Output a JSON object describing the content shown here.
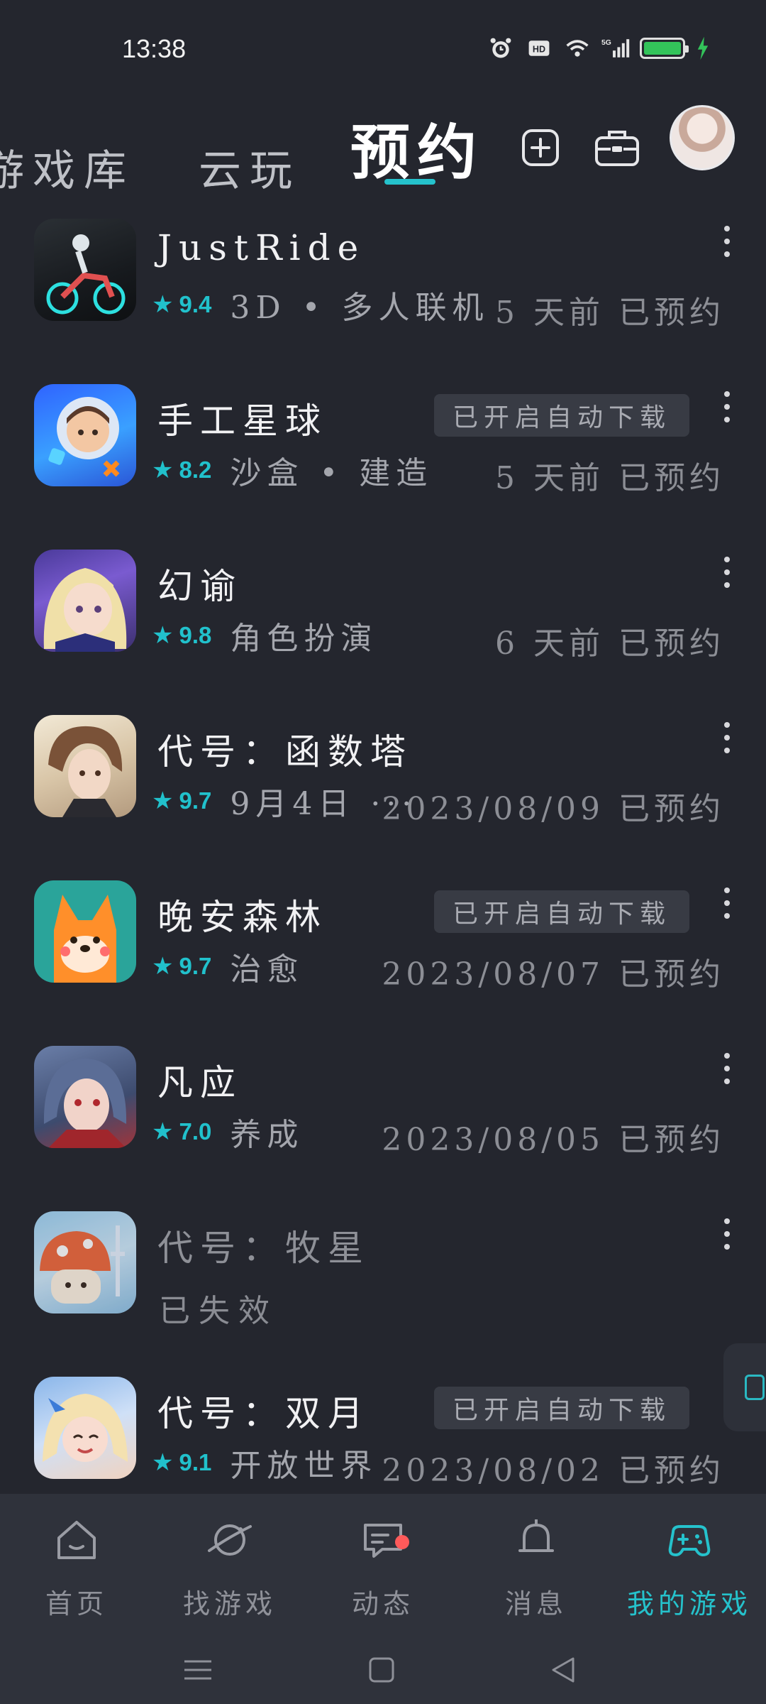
{
  "status_bar": {
    "time": "13:38",
    "icons": [
      "alarm-icon",
      "hd-icon",
      "wifi-icon",
      "5g-signal-icon",
      "battery-icon",
      "charging-icon"
    ],
    "battery_color": "#33c35a"
  },
  "top_nav": {
    "tabs": [
      {
        "label": "游戏库"
      },
      {
        "label": "云玩"
      },
      {
        "label": "预约",
        "active": true
      }
    ],
    "accent": "#25c2cc"
  },
  "reservations": [
    {
      "name": "JustRide",
      "score": "9.4",
      "tags": "3D • 多人联机",
      "date": "5 天前 已预约",
      "badge": ""
    },
    {
      "name": "手工星球",
      "score": "8.2",
      "tags": "沙盒 • 建造",
      "date": "5 天前 已预约",
      "badge": "已开启自动下载"
    },
    {
      "name": "幻谕",
      "score": "9.8",
      "tags": "角色扮演",
      "date": "6 天前 已预约",
      "badge": ""
    },
    {
      "name": "代号：函数塔",
      "score": "9.7",
      "tags": "9月4日 ···",
      "date": "2023/08/09 已预约",
      "badge": ""
    },
    {
      "name": "晚安森林",
      "score": "9.7",
      "tags": "治愈",
      "date": "2023/08/07 已预约",
      "badge": "已开启自动下载"
    },
    {
      "name": "凡应",
      "score": "7.0",
      "tags": "养成",
      "date": "2023/08/05 已预约",
      "badge": ""
    },
    {
      "name": "代号：牧星",
      "score": "",
      "tags": "",
      "date": "",
      "badge": "",
      "status": "已失效"
    },
    {
      "name": "代号：双月",
      "score": "9.1",
      "tags": "开放世界",
      "date": "2023/08/02 已预约",
      "badge": "已开启自动下载"
    }
  ],
  "bottom_nav": [
    {
      "label": "首页",
      "icon": "home-icon"
    },
    {
      "label": "找游戏",
      "icon": "planet-icon"
    },
    {
      "label": "动态",
      "icon": "chat-icon",
      "has_dot": true
    },
    {
      "label": "消息",
      "icon": "bell-icon"
    },
    {
      "label": "我的游戏",
      "icon": "gamepad-icon",
      "active": true
    }
  ]
}
